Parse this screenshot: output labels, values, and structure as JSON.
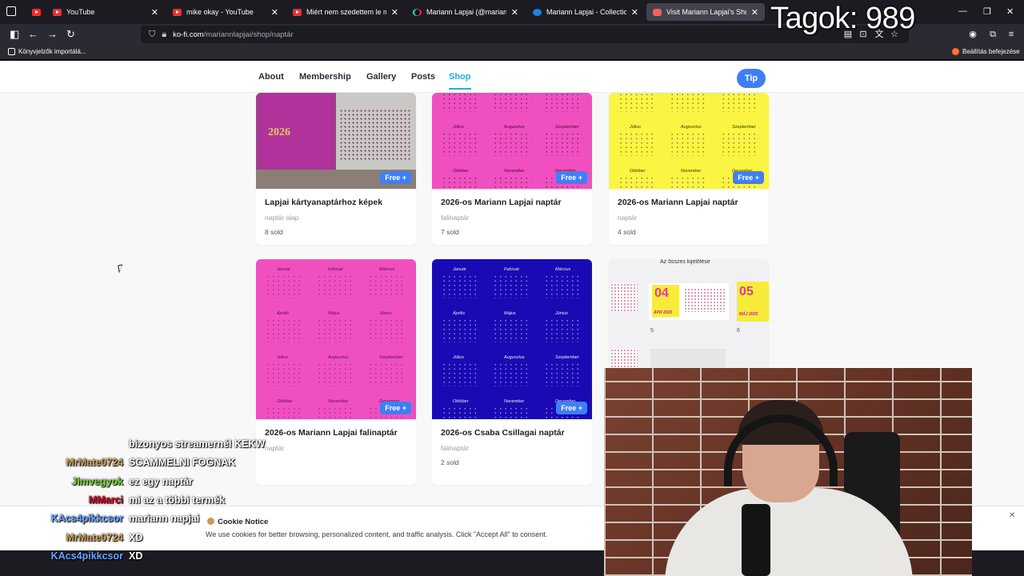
{
  "browser": {
    "tabs": [
      {
        "label": "",
        "icon": "youtube-icon"
      },
      {
        "label": "YouTube",
        "icon": "youtube-icon"
      },
      {
        "label": "mike okay - YouTube",
        "icon": "youtube-icon"
      },
      {
        "label": "Miért nem szedettem le magam",
        "icon": "youtube-icon"
      },
      {
        "label": "Mariann Lapjai (@mariannlapjai",
        "icon": "tiktok-icon"
      },
      {
        "label": "Mariann Lapjai - Collection | Op",
        "icon": "opensea-icon"
      },
      {
        "label": "Visit Mariann Lapjai's Shop!",
        "icon": "kofi-icon",
        "active": true
      }
    ],
    "url_host": "ko-fi.com",
    "url_path": "/mariannlapjai/shop/naptár",
    "bookmarks_left": "Könyvjelzők importálá...",
    "bookmarks_right": "Beállítás befejezése"
  },
  "site": {
    "nav": [
      "About",
      "Membership",
      "Gallery",
      "Posts",
      "Shop"
    ],
    "active_nav": "Shop",
    "tip_label": "Tip",
    "free_label": "Free +",
    "products": [
      {
        "title": "Lapjai kártyanaptárhoz képek",
        "category": "naptár alap",
        "sold": "8 sold"
      },
      {
        "title": "2026-os Mariann Lapjai naptár",
        "category": "falinaptár",
        "sold": "7 sold"
      },
      {
        "title": "2026-os Mariann Lapjai naptár",
        "category": "naptár",
        "sold": "4 sold"
      },
      {
        "title": "2026-os Mariann Lapjai falinaptár",
        "category": "naptár",
        "sold": ""
      },
      {
        "title": "2026-os Csaba Csillagai naptár",
        "category": "falinaptár",
        "sold": "2 sold"
      }
    ],
    "thumb_texts": {
      "year": "2026",
      "select_all": "Az összes kijelölése",
      "page_04": "04",
      "page_05": "05",
      "page_04_sub": "ÁPR 2025",
      "page_05_sub": "MÁJ 2025",
      "page_num_5": "5",
      "page_num_6": "6"
    },
    "months": [
      "Január",
      "Február",
      "Március",
      "Április",
      "Május",
      "Június",
      "Július",
      "Augusztus",
      "Szeptember",
      "Október",
      "November",
      "December"
    ],
    "cookie_title": "Cookie Notice",
    "cookie_text": "We use cookies for better browsing, personalized content, and traffic analysis. Click \"Accept All\" to consent."
  },
  "overlay": {
    "member_counter": "Tagok: 989",
    "chat": [
      {
        "user": "",
        "message": "bizonyos streamernél KEKW",
        "color": "#ffffff"
      },
      {
        "user": "MrMate0724",
        "message": "SCAMMELNI FOGNAK",
        "color": "#d2a35c"
      },
      {
        "user": "Jimvegyok",
        "message": "ez egy naptár",
        "color": "#7dd63f"
      },
      {
        "user": "MMarci",
        "message": "mi az a többi termék",
        "color": "#c8102e"
      },
      {
        "user": "KAcs4pikkcsor",
        "message": "mariann napjai",
        "color": "#6ba4ff"
      },
      {
        "user": "MrMate0724",
        "message": "XD",
        "color": "#d2a35c"
      },
      {
        "user": "KAcs4pikkcsor",
        "message": "XD",
        "color": "#6ba4ff"
      }
    ]
  },
  "colors": {
    "accent": "#3f7ff5",
    "shop_active": "#29abe0",
    "pink_calendar": "#f04fc0",
    "yellow_calendar": "#f9f542",
    "blue_calendar": "#1a0ab3"
  }
}
